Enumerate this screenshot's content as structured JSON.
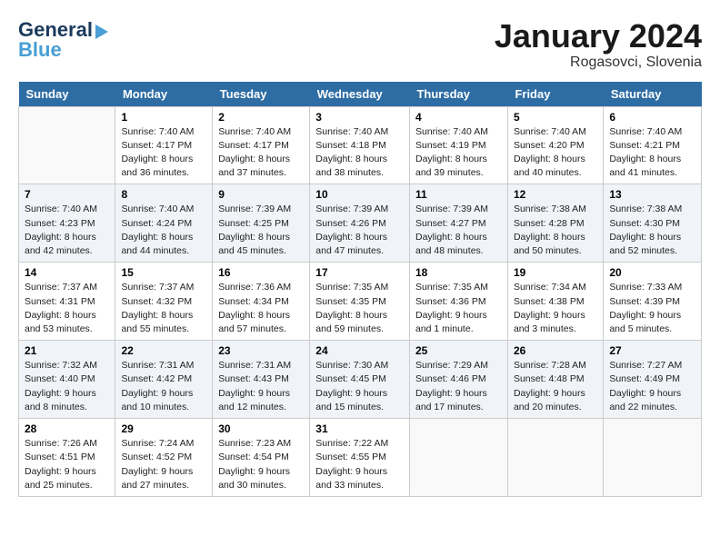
{
  "header": {
    "logo_line1": "General",
    "logo_line2": "Blue",
    "month_title": "January 2024",
    "location": "Rogasovci, Slovenia"
  },
  "days_of_week": [
    "Sunday",
    "Monday",
    "Tuesday",
    "Wednesday",
    "Thursday",
    "Friday",
    "Saturday"
  ],
  "weeks": [
    [
      {
        "num": "",
        "sunrise": "",
        "sunset": "",
        "daylight": ""
      },
      {
        "num": "1",
        "sunrise": "Sunrise: 7:40 AM",
        "sunset": "Sunset: 4:17 PM",
        "daylight": "Daylight: 8 hours and 36 minutes."
      },
      {
        "num": "2",
        "sunrise": "Sunrise: 7:40 AM",
        "sunset": "Sunset: 4:17 PM",
        "daylight": "Daylight: 8 hours and 37 minutes."
      },
      {
        "num": "3",
        "sunrise": "Sunrise: 7:40 AM",
        "sunset": "Sunset: 4:18 PM",
        "daylight": "Daylight: 8 hours and 38 minutes."
      },
      {
        "num": "4",
        "sunrise": "Sunrise: 7:40 AM",
        "sunset": "Sunset: 4:19 PM",
        "daylight": "Daylight: 8 hours and 39 minutes."
      },
      {
        "num": "5",
        "sunrise": "Sunrise: 7:40 AM",
        "sunset": "Sunset: 4:20 PM",
        "daylight": "Daylight: 8 hours and 40 minutes."
      },
      {
        "num": "6",
        "sunrise": "Sunrise: 7:40 AM",
        "sunset": "Sunset: 4:21 PM",
        "daylight": "Daylight: 8 hours and 41 minutes."
      }
    ],
    [
      {
        "num": "7",
        "sunrise": "Sunrise: 7:40 AM",
        "sunset": "Sunset: 4:23 PM",
        "daylight": "Daylight: 8 hours and 42 minutes."
      },
      {
        "num": "8",
        "sunrise": "Sunrise: 7:40 AM",
        "sunset": "Sunset: 4:24 PM",
        "daylight": "Daylight: 8 hours and 44 minutes."
      },
      {
        "num": "9",
        "sunrise": "Sunrise: 7:39 AM",
        "sunset": "Sunset: 4:25 PM",
        "daylight": "Daylight: 8 hours and 45 minutes."
      },
      {
        "num": "10",
        "sunrise": "Sunrise: 7:39 AM",
        "sunset": "Sunset: 4:26 PM",
        "daylight": "Daylight: 8 hours and 47 minutes."
      },
      {
        "num": "11",
        "sunrise": "Sunrise: 7:39 AM",
        "sunset": "Sunset: 4:27 PM",
        "daylight": "Daylight: 8 hours and 48 minutes."
      },
      {
        "num": "12",
        "sunrise": "Sunrise: 7:38 AM",
        "sunset": "Sunset: 4:28 PM",
        "daylight": "Daylight: 8 hours and 50 minutes."
      },
      {
        "num": "13",
        "sunrise": "Sunrise: 7:38 AM",
        "sunset": "Sunset: 4:30 PM",
        "daylight": "Daylight: 8 hours and 52 minutes."
      }
    ],
    [
      {
        "num": "14",
        "sunrise": "Sunrise: 7:37 AM",
        "sunset": "Sunset: 4:31 PM",
        "daylight": "Daylight: 8 hours and 53 minutes."
      },
      {
        "num": "15",
        "sunrise": "Sunrise: 7:37 AM",
        "sunset": "Sunset: 4:32 PM",
        "daylight": "Daylight: 8 hours and 55 minutes."
      },
      {
        "num": "16",
        "sunrise": "Sunrise: 7:36 AM",
        "sunset": "Sunset: 4:34 PM",
        "daylight": "Daylight: 8 hours and 57 minutes."
      },
      {
        "num": "17",
        "sunrise": "Sunrise: 7:35 AM",
        "sunset": "Sunset: 4:35 PM",
        "daylight": "Daylight: 8 hours and 59 minutes."
      },
      {
        "num": "18",
        "sunrise": "Sunrise: 7:35 AM",
        "sunset": "Sunset: 4:36 PM",
        "daylight": "Daylight: 9 hours and 1 minute."
      },
      {
        "num": "19",
        "sunrise": "Sunrise: 7:34 AM",
        "sunset": "Sunset: 4:38 PM",
        "daylight": "Daylight: 9 hours and 3 minutes."
      },
      {
        "num": "20",
        "sunrise": "Sunrise: 7:33 AM",
        "sunset": "Sunset: 4:39 PM",
        "daylight": "Daylight: 9 hours and 5 minutes."
      }
    ],
    [
      {
        "num": "21",
        "sunrise": "Sunrise: 7:32 AM",
        "sunset": "Sunset: 4:40 PM",
        "daylight": "Daylight: 9 hours and 8 minutes."
      },
      {
        "num": "22",
        "sunrise": "Sunrise: 7:31 AM",
        "sunset": "Sunset: 4:42 PM",
        "daylight": "Daylight: 9 hours and 10 minutes."
      },
      {
        "num": "23",
        "sunrise": "Sunrise: 7:31 AM",
        "sunset": "Sunset: 4:43 PM",
        "daylight": "Daylight: 9 hours and 12 minutes."
      },
      {
        "num": "24",
        "sunrise": "Sunrise: 7:30 AM",
        "sunset": "Sunset: 4:45 PM",
        "daylight": "Daylight: 9 hours and 15 minutes."
      },
      {
        "num": "25",
        "sunrise": "Sunrise: 7:29 AM",
        "sunset": "Sunset: 4:46 PM",
        "daylight": "Daylight: 9 hours and 17 minutes."
      },
      {
        "num": "26",
        "sunrise": "Sunrise: 7:28 AM",
        "sunset": "Sunset: 4:48 PM",
        "daylight": "Daylight: 9 hours and 20 minutes."
      },
      {
        "num": "27",
        "sunrise": "Sunrise: 7:27 AM",
        "sunset": "Sunset: 4:49 PM",
        "daylight": "Daylight: 9 hours and 22 minutes."
      }
    ],
    [
      {
        "num": "28",
        "sunrise": "Sunrise: 7:26 AM",
        "sunset": "Sunset: 4:51 PM",
        "daylight": "Daylight: 9 hours and 25 minutes."
      },
      {
        "num": "29",
        "sunrise": "Sunrise: 7:24 AM",
        "sunset": "Sunset: 4:52 PM",
        "daylight": "Daylight: 9 hours and 27 minutes."
      },
      {
        "num": "30",
        "sunrise": "Sunrise: 7:23 AM",
        "sunset": "Sunset: 4:54 PM",
        "daylight": "Daylight: 9 hours and 30 minutes."
      },
      {
        "num": "31",
        "sunrise": "Sunrise: 7:22 AM",
        "sunset": "Sunset: 4:55 PM",
        "daylight": "Daylight: 9 hours and 33 minutes."
      },
      {
        "num": "",
        "sunrise": "",
        "sunset": "",
        "daylight": ""
      },
      {
        "num": "",
        "sunrise": "",
        "sunset": "",
        "daylight": ""
      },
      {
        "num": "",
        "sunrise": "",
        "sunset": "",
        "daylight": ""
      }
    ]
  ]
}
